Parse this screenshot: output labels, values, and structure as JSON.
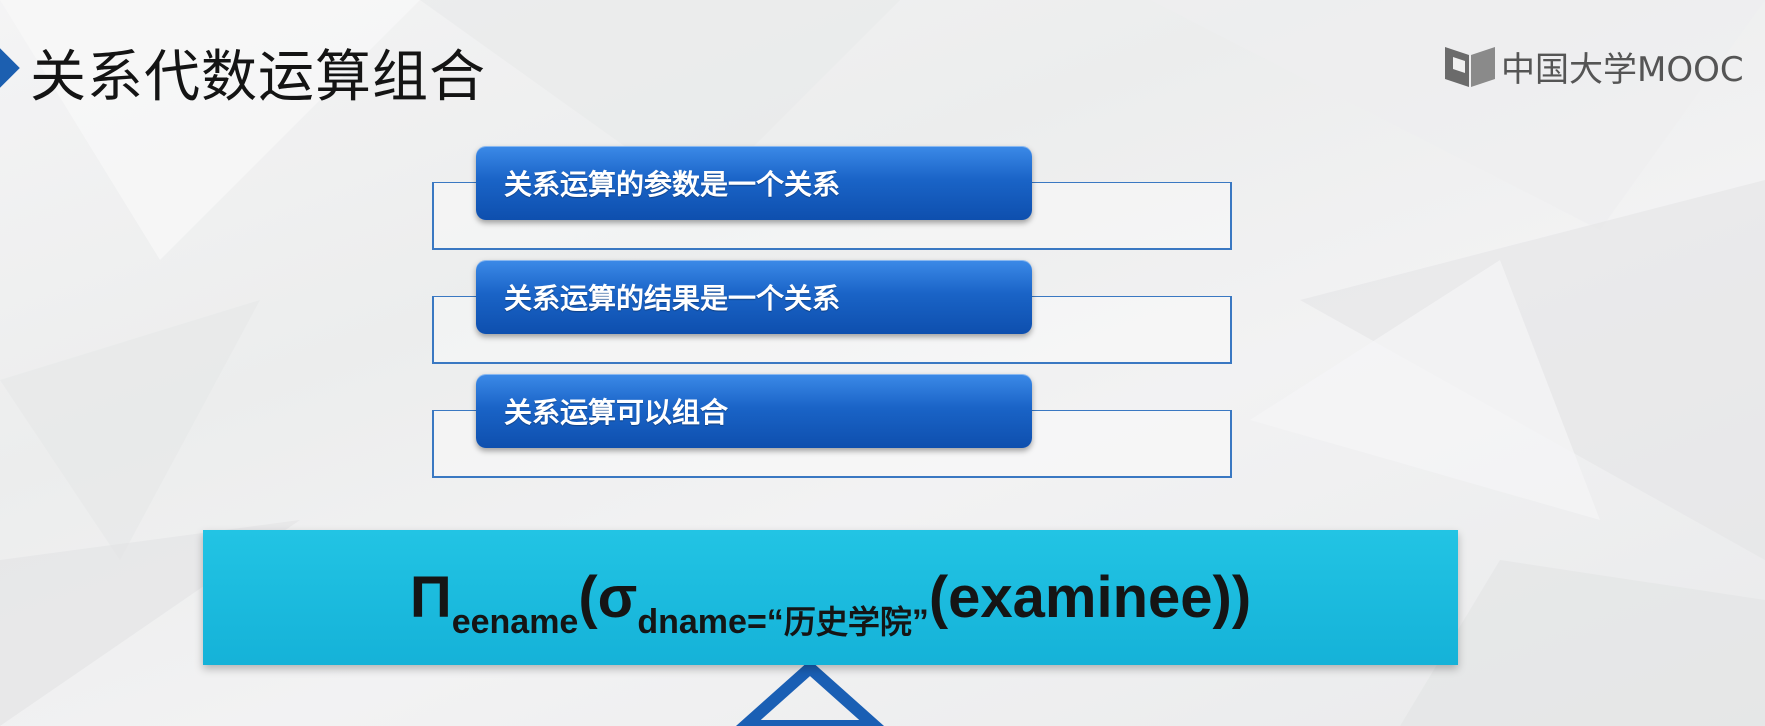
{
  "title": "关系代数运算组合",
  "logo": {
    "text": "中国大学MOOC"
  },
  "items": [
    {
      "label": "关系运算的参数是一个关系"
    },
    {
      "label": "关系运算的结果是一个关系"
    },
    {
      "label": "关系运算可以组合"
    }
  ],
  "formula": {
    "projection_symbol": "Π",
    "projection_attr": "eename",
    "open_paren": "(",
    "selection_symbol": "σ",
    "selection_cond_prefix": "dname=“",
    "selection_cond_value": "历史学院",
    "selection_cond_suffix": "”",
    "relation_part": "(examinee))"
  },
  "colors": {
    "accent_blue": "#1a64c7",
    "formula_bg": "#15b2d8",
    "title_marker": "#1c5fb0"
  },
  "icons": {
    "title_marker": "diamond-marker-icon",
    "logo_mark": "book-logo-icon"
  }
}
